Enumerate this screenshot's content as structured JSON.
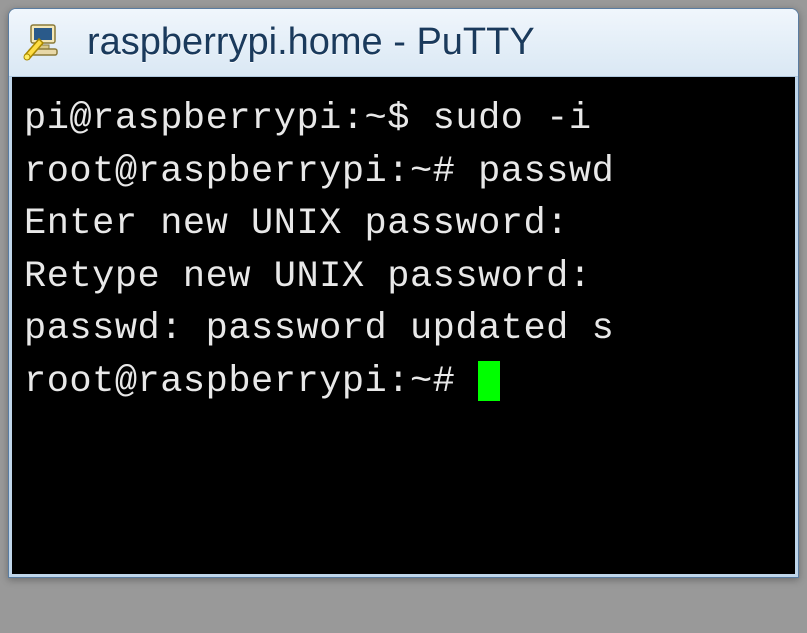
{
  "window": {
    "title": "raspberrypi.home - PuTTY"
  },
  "terminal": {
    "lines": [
      "pi@raspberrypi:~$ sudo -i",
      "root@raspberrypi:~# passwd",
      "Enter new UNIX password:",
      "Retype new UNIX password:",
      "passwd: password updated s",
      "root@raspberrypi:~# "
    ]
  }
}
